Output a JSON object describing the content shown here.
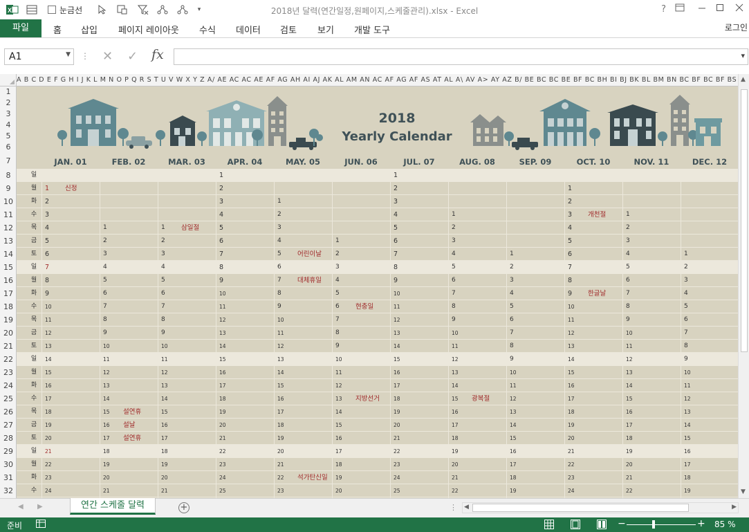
{
  "window": {
    "doc_title": "2018년 달력(연간일정,원페이지,스케줄관리).xlsx - Excel",
    "gridlines_label": "눈금선",
    "help_icon": "?"
  },
  "ribbon": {
    "file": "파일",
    "tabs": [
      "홈",
      "삽입",
      "페이지 레이아웃",
      "수식",
      "데이터",
      "검토",
      "보기",
      "개발 도구"
    ],
    "login": "로그인"
  },
  "formula_bar": {
    "name_box": "A1",
    "fx": "fx",
    "value": ""
  },
  "column_header_text": "A  B  C  D  E  F G H  I  J  K  L  M  N  O  P  Q  R  S  T  U  V  W X  Y  Z  A/ AE AC AC AE AF AG AH AI AJ AK AL AM AN AC AF AG AF AS AT AL A\\ AV A> AY AZ B/ BE BC BC BE BF BC BH BI BJ BK BL BM BN BC BF BC BF BS BT BL BY",
  "row_numbers": [
    1,
    2,
    3,
    4,
    5,
    6,
    7,
    8,
    9,
    10,
    11,
    12,
    13,
    14,
    15,
    16,
    17,
    18,
    19,
    20,
    21,
    22,
    23,
    24,
    25,
    26,
    27,
    28,
    29,
    30,
    31,
    32
  ],
  "calendar": {
    "year": "2018",
    "title": "Yearly Calendar",
    "months": [
      "JAN. 01",
      "FEB. 02",
      "MAR. 03",
      "APR. 04",
      "MAY. 05",
      "JUN. 06",
      "JUL. 07",
      "AUG. 08",
      "SEP. 09",
      "OCT. 10",
      "NOV. 11",
      "DEC. 12"
    ],
    "weekdays": [
      "일",
      "월",
      "화",
      "수",
      "목",
      "금",
      "토",
      "일",
      "월",
      "화",
      "수",
      "목",
      "금",
      "토",
      "일",
      "월",
      "화",
      "수",
      "목",
      "금",
      "토",
      "일",
      "월",
      "화",
      "수"
    ],
    "sunday_rows": [
      0,
      7,
      14,
      21
    ],
    "rows": [
      [
        "",
        "",
        "",
        "1",
        "",
        "",
        "1",
        "",
        "",
        "",
        "",
        ""
      ],
      [
        "1",
        "",
        "",
        "2",
        "",
        "",
        "2",
        "",
        "",
        "1",
        "",
        ""
      ],
      [
        "2",
        "",
        "",
        "3",
        "1",
        "",
        "3",
        "",
        "",
        "2",
        "",
        ""
      ],
      [
        "3",
        "",
        "",
        "4",
        "2",
        "",
        "4",
        "1",
        "",
        "3",
        "1",
        ""
      ],
      [
        "4",
        "1",
        "1",
        "5",
        "3",
        "",
        "5",
        "2",
        "",
        "4",
        "2",
        ""
      ],
      [
        "5",
        "2",
        "2",
        "6",
        "4",
        "1",
        "6",
        "3",
        "",
        "5",
        "3",
        ""
      ],
      [
        "6",
        "3",
        "3",
        "7",
        "5",
        "2",
        "7",
        "4",
        "1",
        "6",
        "4",
        "1"
      ],
      [
        "7",
        "4",
        "4",
        "8",
        "6",
        "3",
        "8",
        "5",
        "2",
        "7",
        "5",
        "2"
      ],
      [
        "8",
        "5",
        "5",
        "9",
        "7",
        "4",
        "9",
        "6",
        "3",
        "8",
        "6",
        "3"
      ],
      [
        "9",
        "6",
        "6",
        "10",
        "8",
        "5",
        "10",
        "7",
        "4",
        "9",
        "7",
        "4"
      ],
      [
        "10",
        "7",
        "7",
        "11",
        "9",
        "6",
        "11",
        "8",
        "5",
        "10",
        "8",
        "5"
      ],
      [
        "11",
        "8",
        "8",
        "12",
        "10",
        "7",
        "12",
        "9",
        "6",
        "11",
        "9",
        "6"
      ],
      [
        "12",
        "9",
        "9",
        "13",
        "11",
        "8",
        "13",
        "10",
        "7",
        "12",
        "10",
        "7"
      ],
      [
        "13",
        "10",
        "10",
        "14",
        "12",
        "9",
        "14",
        "11",
        "8",
        "13",
        "11",
        "8"
      ],
      [
        "14",
        "11",
        "11",
        "15",
        "13",
        "10",
        "15",
        "12",
        "9",
        "14",
        "12",
        "9"
      ],
      [
        "15",
        "12",
        "12",
        "16",
        "14",
        "11",
        "16",
        "13",
        "10",
        "15",
        "13",
        "10"
      ],
      [
        "16",
        "13",
        "13",
        "17",
        "15",
        "12",
        "17",
        "14",
        "11",
        "16",
        "14",
        "11"
      ],
      [
        "17",
        "14",
        "14",
        "18",
        "16",
        "13",
        "18",
        "15",
        "12",
        "17",
        "15",
        "12"
      ],
      [
        "18",
        "15",
        "15",
        "19",
        "17",
        "14",
        "19",
        "16",
        "13",
        "18",
        "16",
        "13"
      ],
      [
        "19",
        "16",
        "16",
        "20",
        "18",
        "15",
        "20",
        "17",
        "14",
        "19",
        "17",
        "14"
      ],
      [
        "20",
        "17",
        "17",
        "21",
        "19",
        "16",
        "21",
        "18",
        "15",
        "20",
        "18",
        "15"
      ],
      [
        "21",
        "18",
        "18",
        "22",
        "20",
        "17",
        "22",
        "19",
        "16",
        "21",
        "19",
        "16"
      ],
      [
        "22",
        "19",
        "19",
        "23",
        "21",
        "18",
        "23",
        "20",
        "17",
        "22",
        "20",
        "17"
      ],
      [
        "23",
        "20",
        "20",
        "24",
        "22",
        "19",
        "24",
        "21",
        "18",
        "23",
        "21",
        "18"
      ],
      [
        "24",
        "21",
        "21",
        "25",
        "23",
        "20",
        "25",
        "22",
        "19",
        "24",
        "22",
        "19"
      ]
    ],
    "red_numbers": [
      [
        1,
        0
      ],
      [
        7,
        0
      ],
      [
        21,
        0
      ]
    ],
    "holidays": [
      {
        "row": 1,
        "col": 0,
        "label": "신정"
      },
      {
        "row": 4,
        "col": 2,
        "label": "삼일절"
      },
      {
        "row": 6,
        "col": 4,
        "label": "어린이날"
      },
      {
        "row": 8,
        "col": 4,
        "label": "대체휴일"
      },
      {
        "row": 10,
        "col": 5,
        "label": "현충일"
      },
      {
        "row": 17,
        "col": 5,
        "label": "지방선거"
      },
      {
        "row": 17,
        "col": 7,
        "label": "광복절"
      },
      {
        "row": 18,
        "col": 1,
        "label": "설연휴"
      },
      {
        "row": 19,
        "col": 1,
        "label": "설날"
      },
      {
        "row": 20,
        "col": 1,
        "label": "설연휴"
      },
      {
        "row": 23,
        "col": 4,
        "label": "석가탄신일"
      },
      {
        "row": 3,
        "col": 9,
        "label": "개천절"
      },
      {
        "row": 9,
        "col": 9,
        "label": "한글날"
      }
    ]
  },
  "sheet_tabs": {
    "active": "연간 스케줄 달력",
    "add_icon": "+"
  },
  "status": {
    "ready": "준비",
    "zoom": "85 %"
  },
  "colors": {
    "excel_green": "#217346",
    "sheet_bg": "#d8d3c0",
    "sunday_bg": "#ece8dc",
    "title_text": "#3f5157",
    "holiday_red": "#a02a2a"
  }
}
